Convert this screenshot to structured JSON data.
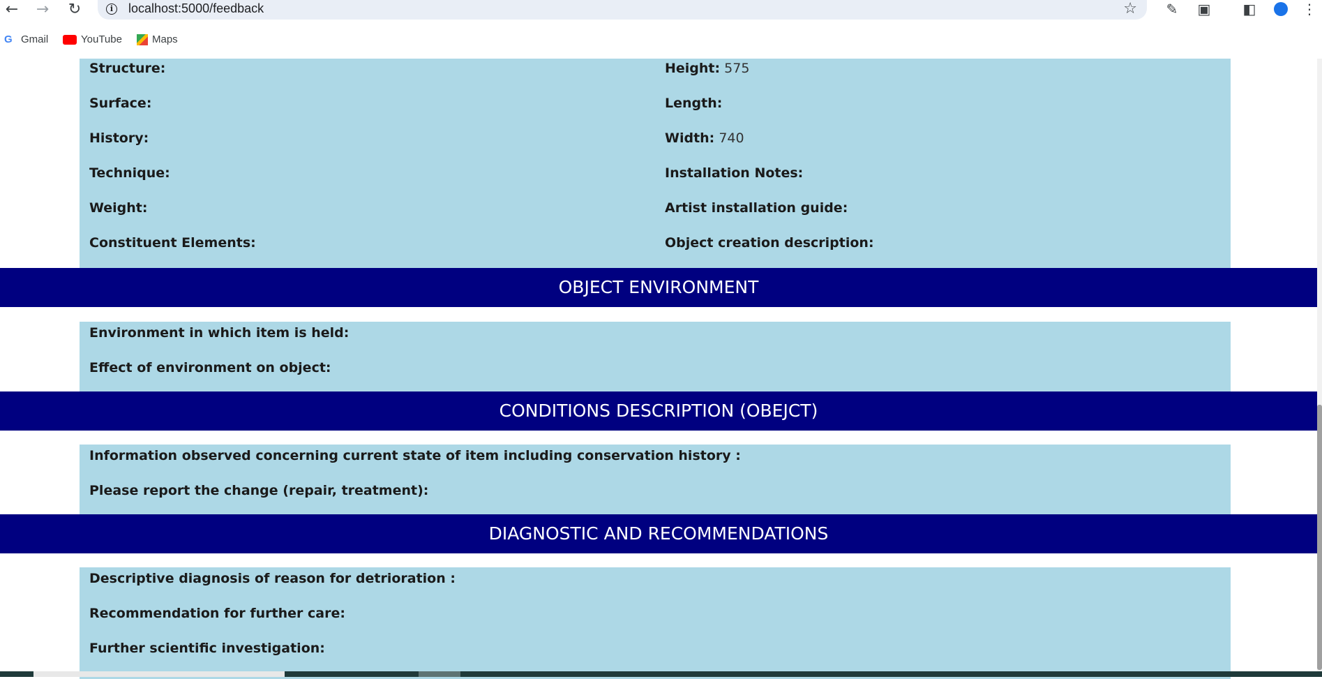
{
  "browser": {
    "url": "localhost:5000/feedback",
    "bookmarks": [
      "Gmail",
      "YouTube",
      "Maps"
    ]
  },
  "object_details": {
    "left": [
      {
        "label": "Structure:",
        "value": ""
      },
      {
        "label": "Surface:",
        "value": ""
      },
      {
        "label": "History:",
        "value": ""
      },
      {
        "label": "Technique:",
        "value": ""
      },
      {
        "label": "Weight:",
        "value": ""
      },
      {
        "label": "Constituent Elements:",
        "value": ""
      }
    ],
    "right": [
      {
        "label": "Height:",
        "value": "575"
      },
      {
        "label": "Length:",
        "value": ""
      },
      {
        "label": "Width:",
        "value": "740"
      },
      {
        "label": "Installation Notes:",
        "value": ""
      },
      {
        "label": "Artist installation guide:",
        "value": ""
      },
      {
        "label": "Object creation description:",
        "value": ""
      }
    ]
  },
  "sections": {
    "environment": {
      "title": "OBJECT ENVIRONMENT",
      "fields": [
        {
          "label": "Environment in which item is held:",
          "value": ""
        },
        {
          "label": "Effect of environment on object:",
          "value": ""
        }
      ]
    },
    "conditions": {
      "title": "CONDITIONS DESCRIPTION (OBEJCT)",
      "fields": [
        {
          "label": "Information observed concerning current state of item including conservation history :",
          "value": ""
        },
        {
          "label": "Please report the change (repair, treatment):",
          "value": ""
        }
      ]
    },
    "diagnostic": {
      "title": "DIAGNOSTIC AND RECOMMENDATIONS",
      "fields": [
        {
          "label": "Descriptive diagnosis of reason for detrioration :",
          "value": ""
        },
        {
          "label": "Recommendation for further care:",
          "value": ""
        },
        {
          "label": "Further scientific investigation:",
          "value": ""
        }
      ]
    }
  },
  "colors": {
    "panel": "#add8e6",
    "banner": "#000080",
    "banner_text": "#ffffff"
  }
}
